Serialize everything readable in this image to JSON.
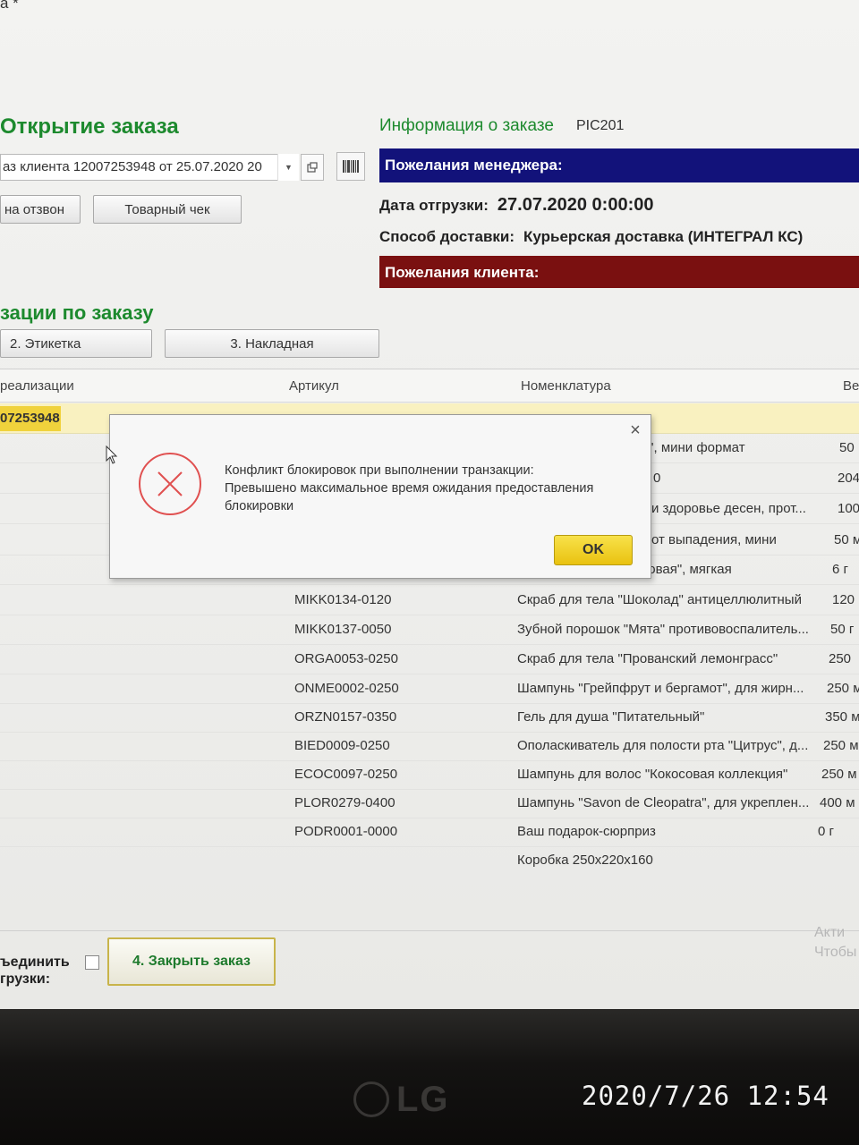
{
  "window": {
    "title_fragment": "а *"
  },
  "order_open": {
    "title": "Открытие заказа",
    "order_field": "аз клиента 12007253948 от 25.07.2020 20",
    "callback_btn": "на отзвон",
    "receipt_btn": "Товарный чек"
  },
  "order_info": {
    "title": "Информация о заказе",
    "code": "PIC201",
    "manager_wishes": "Пожелания менеджера:",
    "ship_date_label": "Дата отгрузки:",
    "ship_date_value": "27.07.2020 0:00:00",
    "delivery_label": "Способ доставки:",
    "delivery_value": "Курьерская доставка (ИНТЕГРАЛ КС)",
    "client_wishes": "Пожелания клиента:"
  },
  "positions": {
    "title": "зации по заказу",
    "label_btn": "2. Этикетка",
    "invoice_btn": "3. Накладная"
  },
  "table": {
    "columns": [
      "реализации",
      "Артикул",
      "Номенклатура",
      "Ве"
    ],
    "selected_row_id": "07253948",
    "partial_rows": [
      {
        "nom": "ый\", мини формат",
        "wt": "50"
      },
      {
        "nom": "0",
        "wt": "204"
      },
      {
        "nom": "и здоровье десен, прот...",
        "wt": "100"
      },
      {
        "nom": "от выпадения, мини",
        "wt": "50 м"
      },
      {
        "nom": "уковая\", мягкая",
        "wt": "6 г"
      }
    ],
    "rows": [
      {
        "art": "MIKK0134-0120",
        "nom": "Скраб для тела \"Шоколад\" антицеллюлитный",
        "wt": "120"
      },
      {
        "art": "MIKK0137-0050",
        "nom": "Зубной порошок \"Мята\" противовоспалитель...",
        "wt": "50 г"
      },
      {
        "art": "ORGA0053-0250",
        "nom": "Скраб для тела \"Прованский лемонграсс\"",
        "wt": "250"
      },
      {
        "art": "ONME0002-0250",
        "nom": "Шампунь \"Грейпфрут и бергамот\", для жирн...",
        "wt": "250 м"
      },
      {
        "art": "ORZN0157-0350",
        "nom": "Гель для душа \"Питательный\"",
        "wt": "350 м"
      },
      {
        "art": "BIED0009-0250",
        "nom": "Ополаскиватель для полости рта \"Цитрус\", д...",
        "wt": "250 м"
      },
      {
        "art": "ECOC0097-0250",
        "nom": "Шампунь для волос \"Кокосовая коллекция\"",
        "wt": "250 м"
      },
      {
        "art": "PLOR0279-0400",
        "nom": "Шампунь \"Savon de Cleopatra\", для укреплен...",
        "wt": "400 м"
      },
      {
        "art": "PODR0001-0000",
        "nom": "Ваш подарок-сюрприз",
        "wt": "0 г"
      },
      {
        "art": "",
        "nom": "Коробка 250х220х160",
        "wt": ""
      }
    ]
  },
  "footer": {
    "combine_label": "ъединить",
    "shipments_label": "грузки:",
    "close_order_btn": "4. Закрыть заказ",
    "activate_line1": "Акти",
    "activate_line2": "Чтобы"
  },
  "dialog": {
    "close_glyph": "×",
    "line1": "Конфликт блокировок при выполнении транзакции:",
    "line2": "Превышено максимальное время ожидания предоставления",
    "line3": "блокировки",
    "ok": "OK"
  },
  "bezel": {
    "logo": "LG",
    "photo_timestamp": "2020/7/26  12:54"
  },
  "colors": {
    "green_title": "#1d8a2e",
    "manager_bar": "#12127a",
    "client_bar": "#7a1010",
    "selected_row": "#f9f1c0",
    "ok_button": "#f0d23c"
  }
}
